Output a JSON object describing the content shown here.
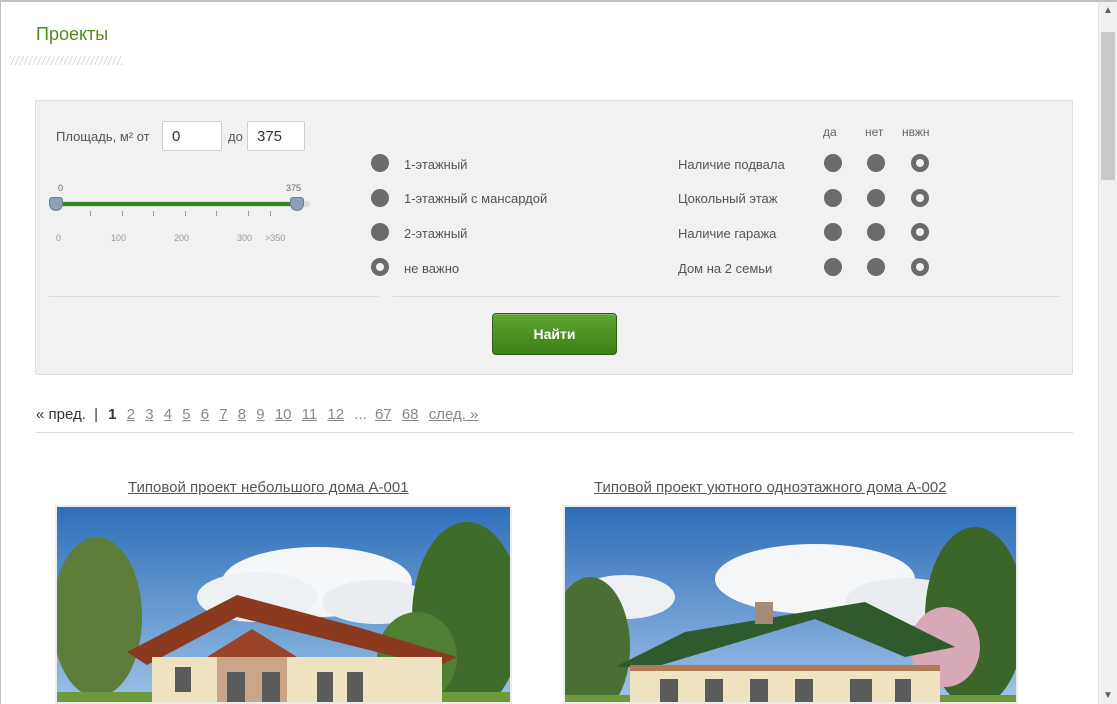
{
  "page": {
    "title": "Проекты"
  },
  "filter": {
    "area": {
      "label": "Площадь, м² от",
      "to_label": "до",
      "from_value": "0",
      "to_value": "375",
      "slider_min_label": "0",
      "slider_max_label": "375",
      "scale": [
        "0",
        "100",
        "200",
        "300",
        ">350"
      ]
    },
    "floors": [
      {
        "label": "1-этажный",
        "selected": false
      },
      {
        "label": "1-этажный с мансардой",
        "selected": false
      },
      {
        "label": "2-этажный",
        "selected": false
      },
      {
        "label": "не важно",
        "selected": true
      }
    ],
    "columns": [
      "да",
      "нет",
      "нвжн"
    ],
    "features": [
      {
        "label": "Наличие подвала",
        "selected": "нвжн"
      },
      {
        "label": "Цокольный этаж",
        "selected": "нвжн"
      },
      {
        "label": "Наличие гаража",
        "selected": "нвжн"
      },
      {
        "label": "Дом на 2 семьи",
        "selected": "нвжн"
      }
    ],
    "find_label": "Найти"
  },
  "pagination": {
    "prev": "« пред.",
    "separator": "|",
    "current": "1",
    "pages": [
      "2",
      "3",
      "4",
      "5",
      "6",
      "7",
      "8",
      "9",
      "10",
      "11",
      "12"
    ],
    "ellipsis": "...",
    "last_pages": [
      "67",
      "68"
    ],
    "next": "след. »"
  },
  "projects": [
    {
      "title": "Типовой проект небольшого дома А-001"
    },
    {
      "title": "Типовой проект уютного одноэтажного дома А-002"
    }
  ],
  "colors": {
    "title_green": "#4f8a1e",
    "button_green": "#4a9324",
    "slider_green": "#2e8b1e"
  }
}
